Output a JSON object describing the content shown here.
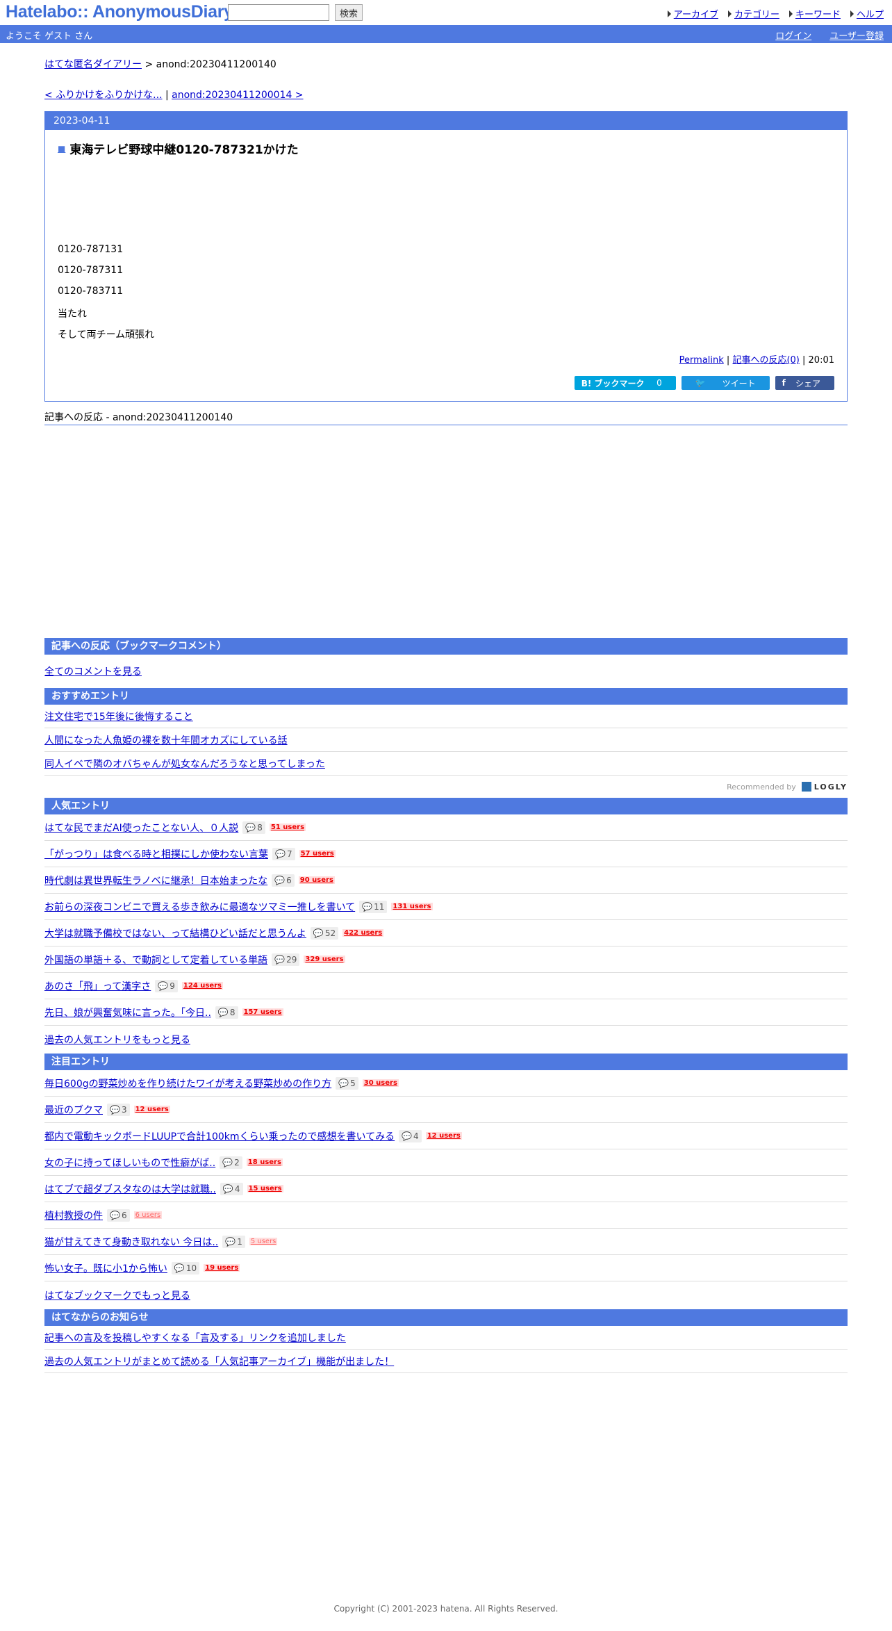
{
  "header": {
    "logo": "Hatelabo:: AnonymousDiary",
    "search_placeholder": "",
    "search_button": "検索",
    "nav": [
      "アーカイブ",
      "カテゴリー",
      "キーワード",
      "ヘルプ"
    ]
  },
  "welcome": {
    "greeting": "ようこそ ゲスト さん",
    "login": "ログイン",
    "register": "ユーザー登録"
  },
  "breadcrumb": {
    "home": "はてな匿名ダイアリー",
    "sep": " > ",
    "current": "anond:20230411200140"
  },
  "prevnext": {
    "prev": "< ふりかけをふりかけな...",
    "sep": " | ",
    "next": "anond:20230411200014 >"
  },
  "entry": {
    "date": "2023-04-11",
    "title": "東海テレビ野球中継0120-787321かけた",
    "lines": [
      "0120-787131",
      "0120-787311",
      "0120-783711",
      "当たれ",
      "そして両チーム頑張れ"
    ],
    "permalink": "Permalink",
    "reactions_link": "記事への反応(0)",
    "time": "20:01",
    "share": {
      "bookmark": "B! ブックマーク",
      "bookmark_count": "0",
      "tweet": "ツイート",
      "fb": "シェア"
    }
  },
  "reaction_title": "記事への反応 - anond:20230411200140",
  "bookmark_comment": {
    "title": "記事への反応（ブックマークコメント）",
    "all_link": "全てのコメントを見る"
  },
  "recommend": {
    "title": "おすすめエントリ",
    "items": [
      "注文住宅で15年後に後悔すること",
      "人間になった人魚姫の裸を数十年間オカズにしている話",
      "同人イベで隣のオバちゃんが処女なんだろうなと思ってしまった"
    ],
    "recommended_by": "Recommended by",
    "logly": "LOGLY"
  },
  "popular": {
    "title": "人気エントリ",
    "items": [
      {
        "title": "はてな民でまだAI使ったことない人、０人説",
        "comments": "8",
        "users": "51 users"
      },
      {
        "title": "「がっつり」は食べる時と相撲にしか使わない言葉",
        "comments": "7",
        "users": "57 users"
      },
      {
        "title": "時代劇は異世界転生ラノベに継承！日本始まったな",
        "comments": "6",
        "users": "90 users"
      },
      {
        "title": "お前らの深夜コンビニで買える歩き飲みに最適なツマミ一推しを書いて",
        "comments": "11",
        "users": "131 users"
      },
      {
        "title": "大学は就職予備校ではない、って結構ひどい話だと思うんよ",
        "comments": "52",
        "users": "422 users"
      },
      {
        "title": "外国語の単語＋る、で動詞として定着している単語",
        "comments": "29",
        "users": "329 users"
      },
      {
        "title": "あのさ「飛」って漢字さ",
        "comments": "9",
        "users": "124 users"
      },
      {
        "title": "先日、娘が興奮気味に言った。「今日..",
        "comments": "8",
        "users": "157 users"
      }
    ],
    "more": "過去の人気エントリをもっと見る"
  },
  "hot": {
    "title": "注目エントリ",
    "items": [
      {
        "title": "毎日600gの野菜炒めを作り続けたワイが考える野菜炒めの作り方",
        "comments": "5",
        "users": "30 users"
      },
      {
        "title": "最近のブクマ",
        "comments": "3",
        "users": "12 users"
      },
      {
        "title": "都内で電動キックボードLUUPで合計100kmくらい乗ったので感想を書いてみる",
        "comments": "4",
        "users": "12 users"
      },
      {
        "title": "女の子に持ってほしいもので性癖がば..",
        "comments": "2",
        "users": "18 users"
      },
      {
        "title": "はてブで超ダブスタなのは大学は就職..",
        "comments": "4",
        "users": "15 users"
      },
      {
        "title": "植村教授の件",
        "comments": "6",
        "users": "6 users"
      },
      {
        "title": "猫が甘えてきて身動き取れない 今日は..",
        "comments": "1",
        "users": "5 users"
      },
      {
        "title": "怖い女子。既に小1から怖い",
        "comments": "10",
        "users": "19 users"
      }
    ],
    "more": "はてなブックマークでもっと見る"
  },
  "news": {
    "title": "はてなからのお知らせ",
    "items": [
      "記事への言及を投稿しやすくなる「言及する」リンクを追加しました",
      "過去の人気エントリがまとめて読める「人気記事アーカイブ」機能が出ました！"
    ]
  },
  "footer": "Copyright (C) 2001-2023 hatena. All Rights Reserved."
}
